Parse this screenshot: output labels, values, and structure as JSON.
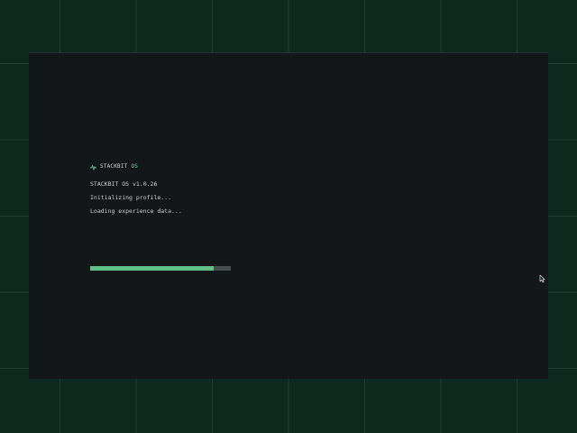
{
  "boot": {
    "brand_name": "STACKBIT",
    "brand_suffix": "OS",
    "lines": [
      "STACKBIT OS v1.0.26",
      "Initializing profile...",
      "Loading experience data..."
    ],
    "progress": 0.88
  },
  "colors": {
    "background": "#0c2b1e",
    "window": "#141719",
    "accent": "#6fcf97",
    "progress_fill": "#5fbf86",
    "progress_track": "#474d4f",
    "text": "#c9ced0"
  },
  "icons": {
    "brand": "pulse-icon",
    "pointer": "mouse-cursor-icon"
  }
}
